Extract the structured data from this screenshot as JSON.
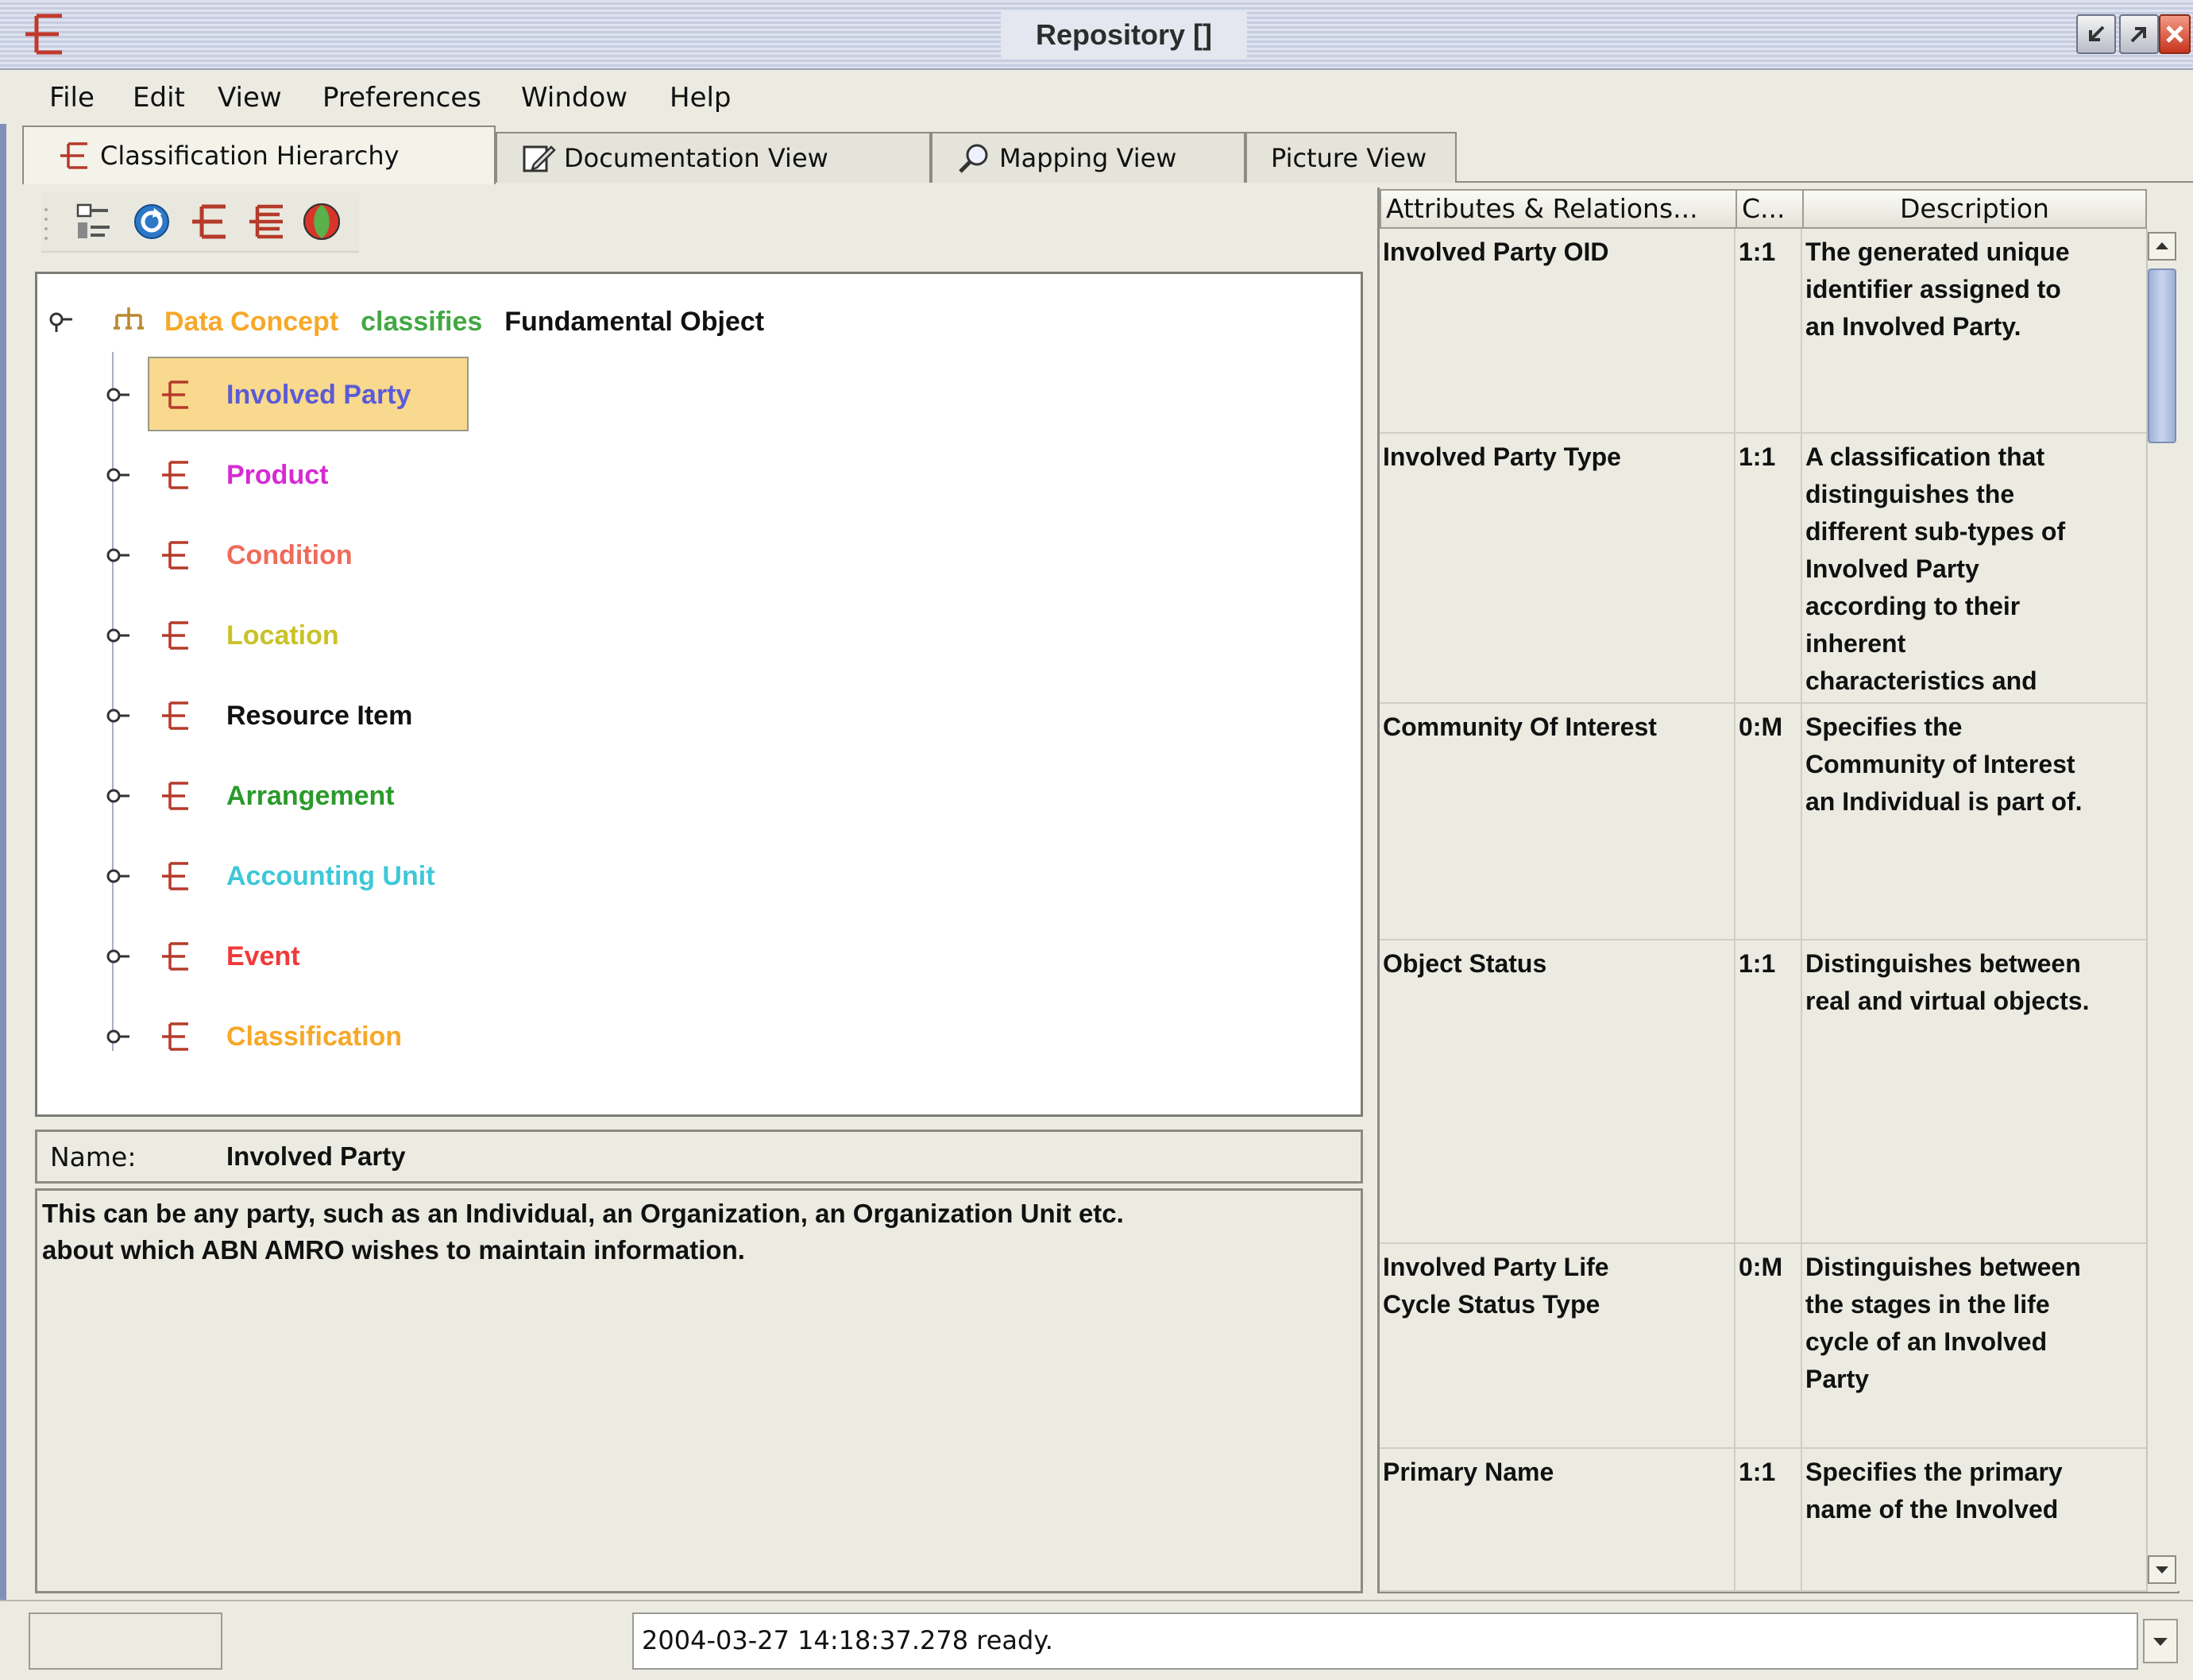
{
  "window": {
    "title": "Repository []"
  },
  "menu": {
    "items": [
      "File",
      "Edit",
      "View",
      "Preferences",
      "Window",
      "Help"
    ]
  },
  "tabs": [
    {
      "label": "Classification Hierarchy",
      "icon": "classification-icon",
      "active": true
    },
    {
      "label": "Documentation View",
      "icon": "edit-document-icon",
      "active": false
    },
    {
      "label": "Mapping View",
      "icon": "magnifier-icon",
      "active": false
    },
    {
      "label": "Picture View",
      "icon": "",
      "active": false
    }
  ],
  "toolbar": {
    "icons": [
      "hierarchy-toggle-icon",
      "refresh-icon",
      "classification-icon",
      "multi-classification-icon",
      "globe-icon"
    ]
  },
  "tree": {
    "root": {
      "subject": "Data Concept",
      "verb": "classifies",
      "object": "Fundamental Object"
    },
    "items": [
      {
        "label": "Involved Party",
        "color": "#5b5bd6",
        "selected": true
      },
      {
        "label": "Product",
        "color": "#d52bd4"
      },
      {
        "label": "Condition",
        "color": "#f06a5a"
      },
      {
        "label": "Location",
        "color": "#c9c228"
      },
      {
        "label": "Resource Item",
        "color": "#111111"
      },
      {
        "label": "Arrangement",
        "color": "#2a9a2a"
      },
      {
        "label": "Accounting Unit",
        "color": "#3ec8d8"
      },
      {
        "label": "Event",
        "color": "#f03a3a"
      },
      {
        "label": "Classification",
        "color": "#f6a828"
      }
    ],
    "root_colors": {
      "subject": "#f6a828",
      "verb": "#43a843",
      "object": "#111111"
    }
  },
  "details": {
    "name_label": "Name:",
    "name_value": "Involved Party",
    "description_lines": [
      "This can be any party, such as an Individual, an Organization, an Organization Unit etc.",
      "about which ABN AMRO wishes to maintain information."
    ]
  },
  "attributes": {
    "columns": [
      "Attributes & Relations...",
      "C...",
      "Description"
    ],
    "rows": [
      {
        "name": [
          "Involved Party OID"
        ],
        "card": "1:1",
        "desc": [
          "The generated unique",
          "identifier assigned to",
          "an Involved Party."
        ]
      },
      {
        "name": [
          "Involved Party Type"
        ],
        "card": "1:1",
        "desc": [
          "A classification that",
          "distinguishes the",
          "different sub-types of",
          "Involved Party",
          "according to their",
          "inherent",
          "characteristics and"
        ]
      },
      {
        "name": [
          "Community Of Interest"
        ],
        "card": "0:M",
        "desc": [
          "Specifies the",
          "Community of Interest",
          "an Individual is part of."
        ]
      },
      {
        "name": [
          "Object Status"
        ],
        "card": "1:1",
        "desc": [
          "Distinguishes between",
          "real and virtual objects."
        ]
      },
      {
        "name": [
          "Involved Party Life",
          "Cycle Status Type"
        ],
        "card": "0:M",
        "desc": [
          "Distinguishes between",
          "the stages in the life",
          "cycle of an Involved",
          "Party"
        ]
      },
      {
        "name": [
          "Primary Name"
        ],
        "card": "1:1",
        "desc": [
          "Specifies the primary",
          "name of the Involved"
        ]
      }
    ]
  },
  "status": {
    "message": "2004-03-27 14:18:37.278 ready."
  },
  "colors": {
    "icon_red": "#b53a2a",
    "selection": "#f8d98d",
    "tree_line": "#a8b0c6"
  }
}
